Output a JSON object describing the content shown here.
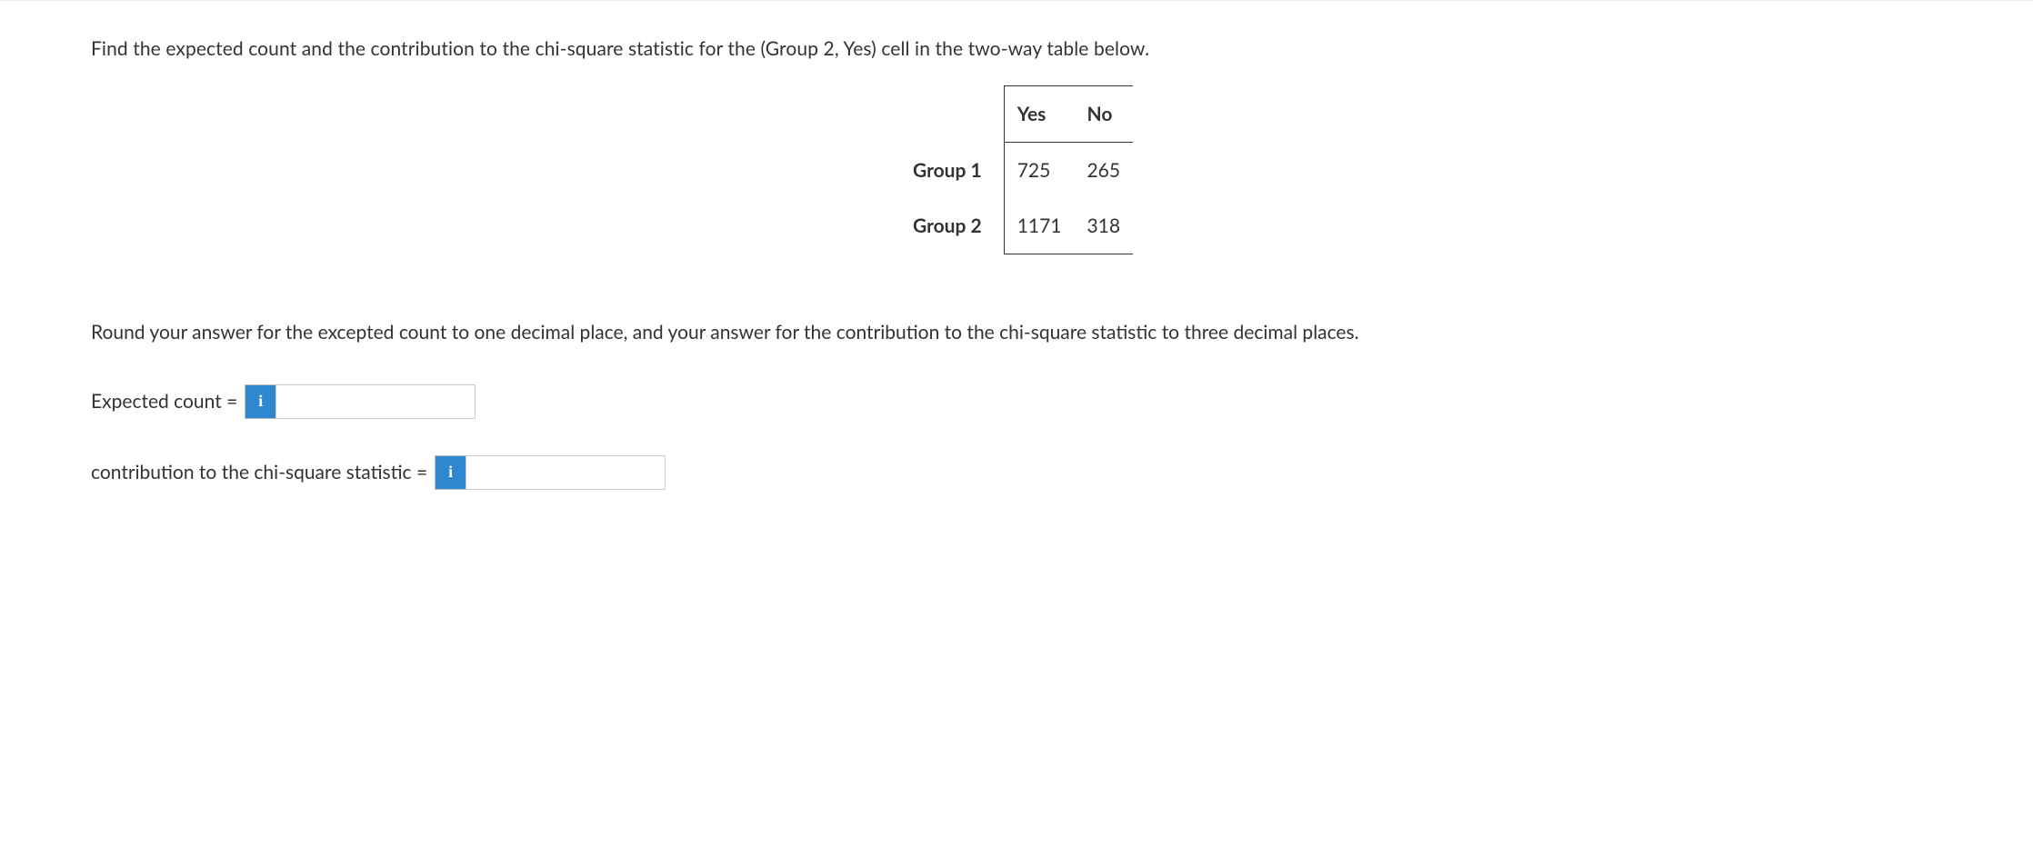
{
  "question": "Find the expected count and the contribution to the chi-square statistic for the (Group 2, Yes) cell in the two-way table below.",
  "table": {
    "headers": {
      "col1": "",
      "col2": "Yes",
      "col3": "No"
    },
    "rows": [
      {
        "label": "Group 1",
        "yes": "725",
        "no": "265"
      },
      {
        "label": "Group 2",
        "yes": "1171",
        "no": "318"
      }
    ]
  },
  "instruction": "Round your answer for the excepted count to one decimal place, and your answer for the contribution to the chi-square statistic to three decimal places.",
  "answers": {
    "expected_label": "Expected count =",
    "contribution_label": "contribution to the chi-square statistic =",
    "info_glyph": "i",
    "expected_value": "",
    "contribution_value": ""
  }
}
